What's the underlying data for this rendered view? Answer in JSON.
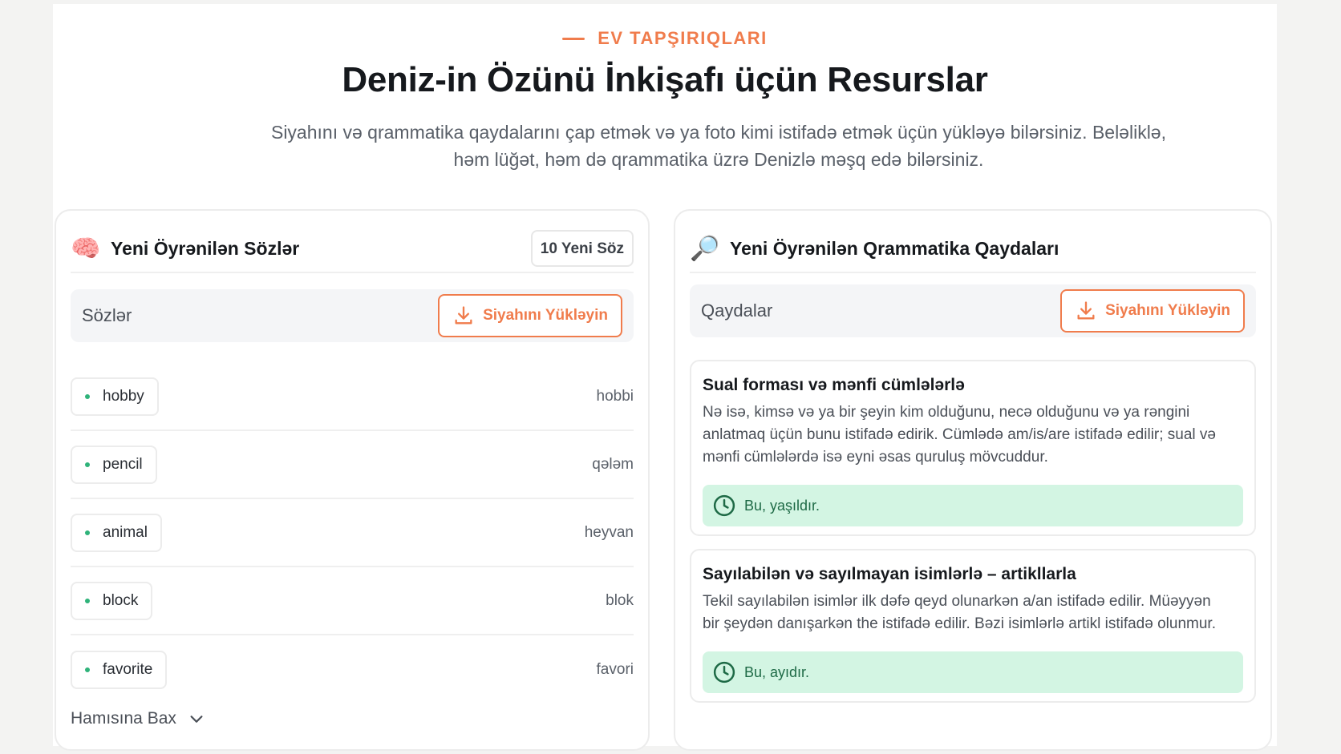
{
  "header": {
    "eyebrow": "EV TAPŞIRIQLARI",
    "title": "Deniz-in Özünü İnkişafı üçün Resurslar",
    "subtitle": "Siyahını və qrammatika qaydalarını çap etmək və ya foto kimi istifadə etmək üçün yükləyə bilərsiniz. Beləliklə, həm lüğət, həm də qrammatika üzrə Denizlə məşq edə bilərsiniz."
  },
  "vocab": {
    "emoji": "🧠",
    "title": "Yeni Öyrənilən Sözlər",
    "badge": "10 Yeni Söz",
    "bar_label": "Sözlər",
    "download_label": "Siyahını Yükləyin",
    "words": [
      {
        "en": "hobby",
        "az": "hobbi"
      },
      {
        "en": "pencil",
        "az": "qələm"
      },
      {
        "en": "animal",
        "az": "heyvan"
      },
      {
        "en": "block",
        "az": "blok"
      },
      {
        "en": "favorite",
        "az": "favori"
      }
    ],
    "view_all": "Hamısına Bax"
  },
  "grammar": {
    "emoji": "🔎",
    "title": "Yeni Öyrənilən Qrammatika Qaydaları",
    "bar_label": "Qaydalar",
    "download_label": "Siyahını Yükləyin",
    "rules": [
      {
        "title": "Sual forması və mənfi cümlələrlə",
        "body": "Nə isə, kimsə və ya bir şeyin kim olduğunu, necə olduğunu və ya rəngini anlatmaq üçün bunu istifadə edirik. Cümlədə am/is/are istifadə edilir; sual və mənfi cümlələrdə isə eyni əsas quruluş mövcuddur.",
        "example": "Bu, yaşıldır."
      },
      {
        "title": "Sayılabilən və sayılmayan isimlərlə – artikllarla",
        "body": "Tekil sayılabilən isimlər ilk dəfə qeyd olunarkən a/an istifadə edilir. Müəyyən bir şeydən danışarkən the istifadə edilir. Bəzi isimlərlə artikl istifadə olunmur.",
        "example": "Bu, ayıdır."
      }
    ]
  },
  "colors": {
    "accent": "#f07c4c",
    "success_bg": "#d3f5e3",
    "success_text": "#1e6a46",
    "dot": "#2fb37a"
  },
  "icons": {
    "download": "download-icon",
    "clock": "clock-icon",
    "chevron": "chevron-down-icon"
  }
}
